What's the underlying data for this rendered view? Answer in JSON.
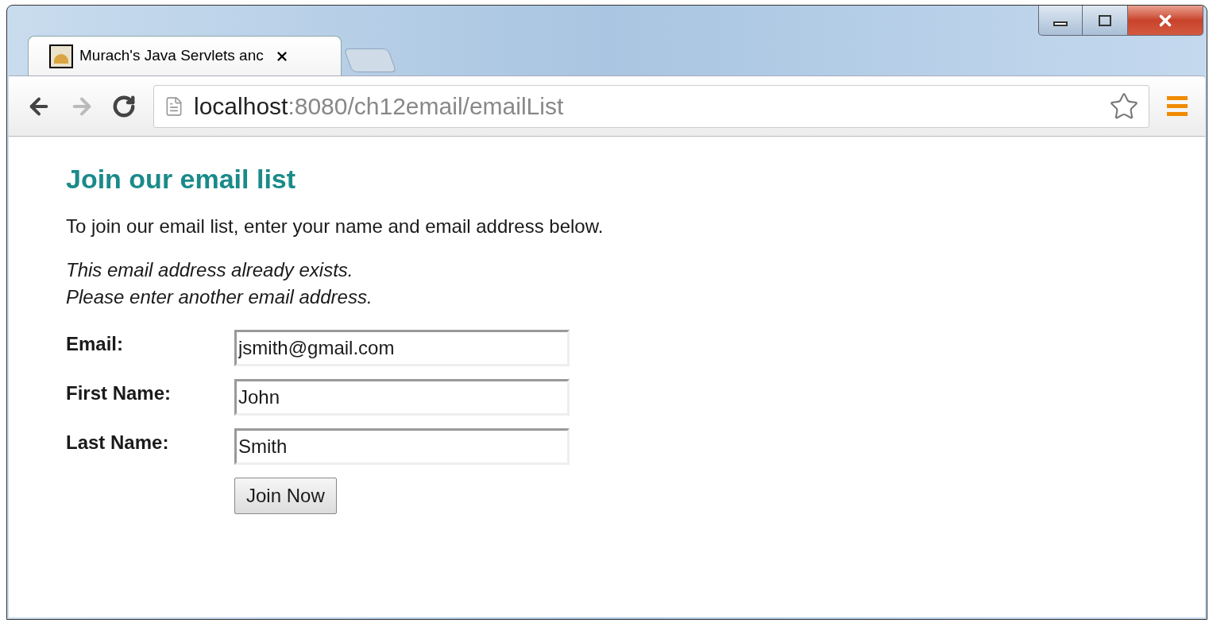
{
  "tabs": [
    {
      "title": "Murach's Java Servlets anc",
      "selected": true
    }
  ],
  "address_bar": {
    "host": "localhost",
    "path": ":8080/ch12email/emailList"
  },
  "page": {
    "heading": "Join our email list",
    "intro": "To join our email list, enter your name and email address below.",
    "message": [
      "This email address already exists.",
      "Please enter another email address."
    ],
    "fields": [
      {
        "label": "Email:",
        "value": "jsmith@gmail.com"
      },
      {
        "label": "First Name:",
        "value": "John"
      },
      {
        "label": "Last Name:",
        "value": "Smith"
      }
    ],
    "submit": "Join Now"
  }
}
